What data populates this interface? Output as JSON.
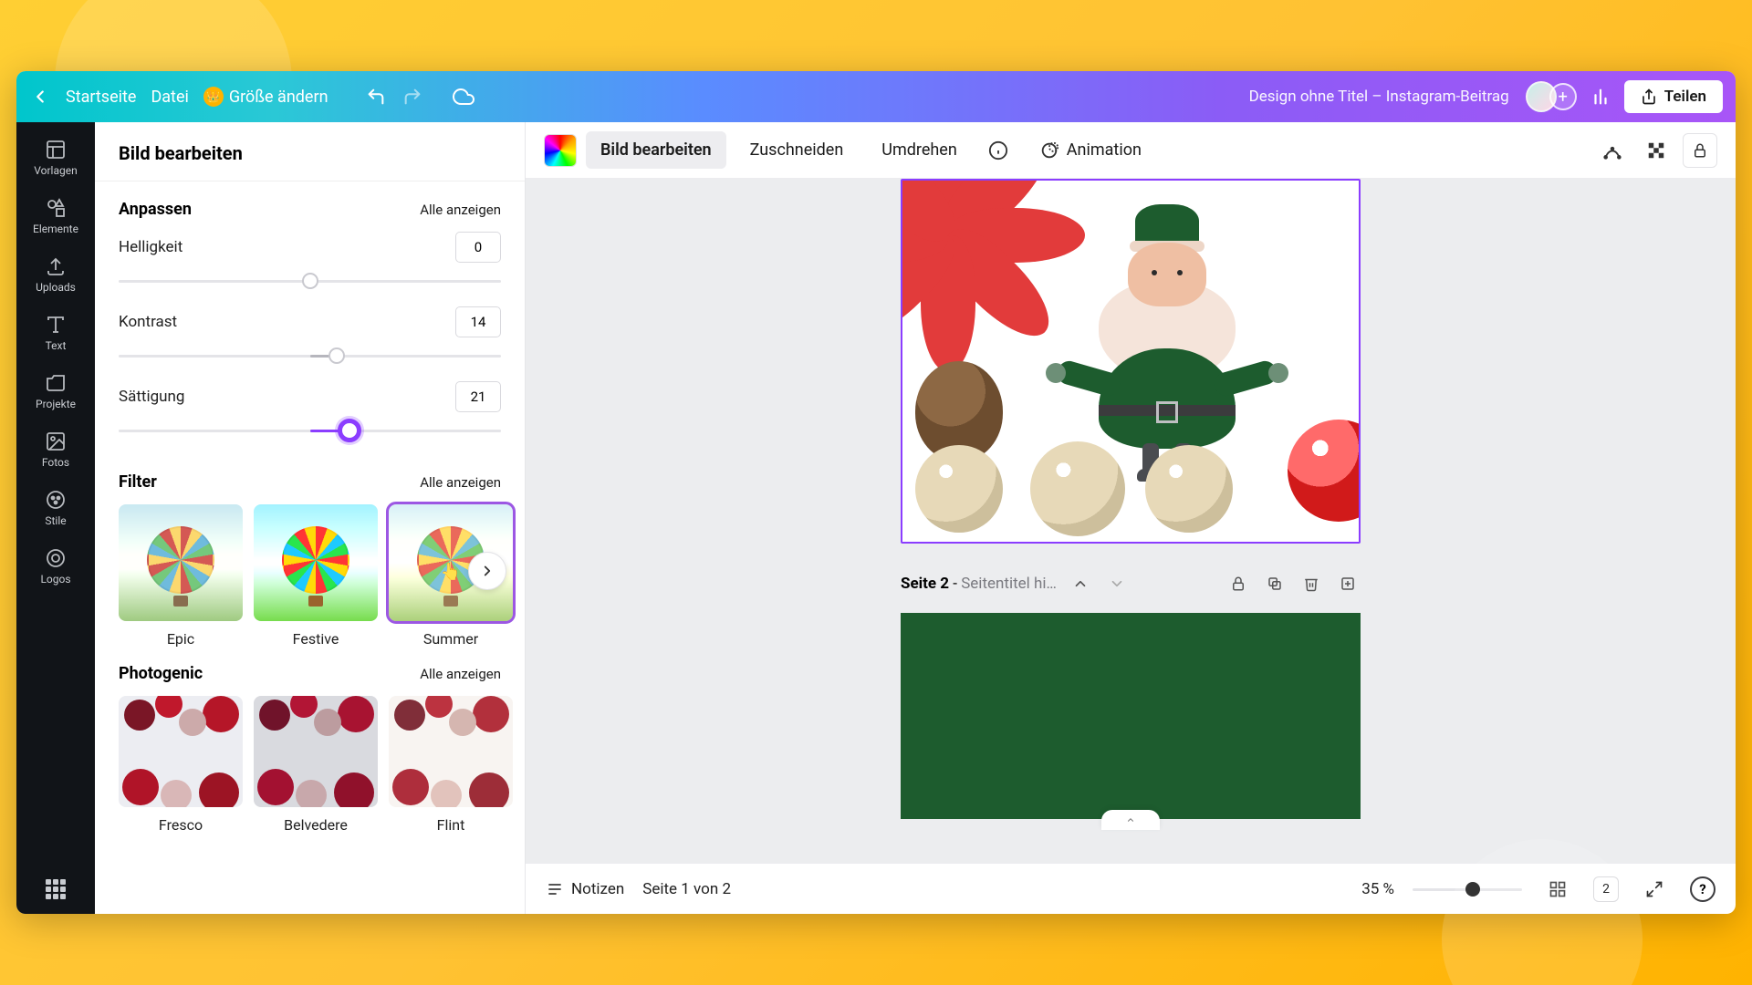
{
  "topbar": {
    "home": "Startseite",
    "file": "Datei",
    "resize": "Größe ändern",
    "title": "Design ohne Titel – Instagram-Beitrag",
    "share": "Teilen"
  },
  "rail": {
    "templates": "Vorlagen",
    "elements": "Elemente",
    "uploads": "Uploads",
    "text": "Text",
    "projects": "Projekte",
    "photos": "Fotos",
    "styles": "Stile",
    "logos": "Logos"
  },
  "panel": {
    "title": "Bild bearbeiten",
    "adjust_heading": "Anpassen",
    "show_all": "Alle anzeigen",
    "brightness_label": "Helligkeit",
    "brightness_value": "0",
    "contrast_label": "Kontrast",
    "contrast_value": "14",
    "saturation_label": "Sättigung",
    "saturation_value": "21",
    "filter_heading": "Filter",
    "filters": {
      "epic": "Epic",
      "festive": "Festive",
      "summer": "Summer"
    },
    "photogenic_heading": "Photogenic",
    "photogenic": {
      "fresco": "Fresco",
      "belvedere": "Belvedere",
      "flint": "Flint"
    }
  },
  "toolbar": {
    "edit_image": "Bild bearbeiten",
    "crop": "Zuschneiden",
    "flip": "Umdrehen",
    "animation": "Animation"
  },
  "pages": {
    "page2_label": "Seite 2",
    "page2_separator": " - ",
    "page2_placeholder": "Seitentitel hi…"
  },
  "bottom": {
    "notes": "Notizen",
    "page_indicator": "Seite 1 von 2",
    "zoom_label": "35 %",
    "zoom_value_pct": 35,
    "page_count": "2"
  }
}
